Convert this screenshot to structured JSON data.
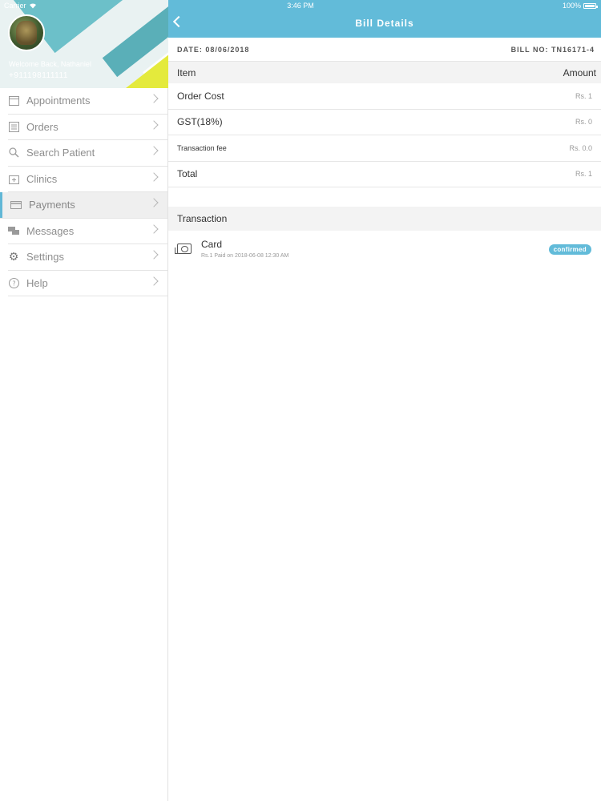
{
  "status_bar": {
    "carrier": "Carrier",
    "time": "3:46 PM",
    "battery": "100%"
  },
  "profile": {
    "welcome": "Welcome Back, Nathaniel",
    "phone": "+911198111111"
  },
  "menu": {
    "items": [
      {
        "label": "Appointments",
        "icon": "calendar-icon"
      },
      {
        "label": "Orders",
        "icon": "list-icon"
      },
      {
        "label": "Search Patient",
        "icon": "search-icon"
      },
      {
        "label": "Clinics",
        "icon": "clinic-icon"
      },
      {
        "label": "Payments",
        "icon": "credit-card-icon",
        "active": true
      },
      {
        "label": "Messages",
        "icon": "chat-icon"
      },
      {
        "label": "Settings",
        "icon": "gear-icon"
      },
      {
        "label": "Help",
        "icon": "help-icon"
      }
    ]
  },
  "nav": {
    "title": "Bill Details"
  },
  "bill": {
    "date": "DATE: 08/06/2018",
    "bill_no": "BILL NO: TN16171-4",
    "header_item": "Item",
    "header_amount": "Amount",
    "rows": [
      {
        "label": "Order Cost",
        "value": "Rs. 1"
      },
      {
        "label": "GST(18%)",
        "value": "Rs. 0"
      },
      {
        "label": "Transaction fee",
        "value": "Rs. 0.0"
      },
      {
        "label": "Total",
        "value": "Rs. 1"
      }
    ]
  },
  "transaction": {
    "header": "Transaction",
    "method": "Card",
    "detail": "Rs.1 Paid on 2018-06-08 12:30 AM",
    "status": "confirmed"
  },
  "colors": {
    "accent": "#62bbd9",
    "teal": "#6cc0c9",
    "yellow": "#e4ea3c"
  }
}
